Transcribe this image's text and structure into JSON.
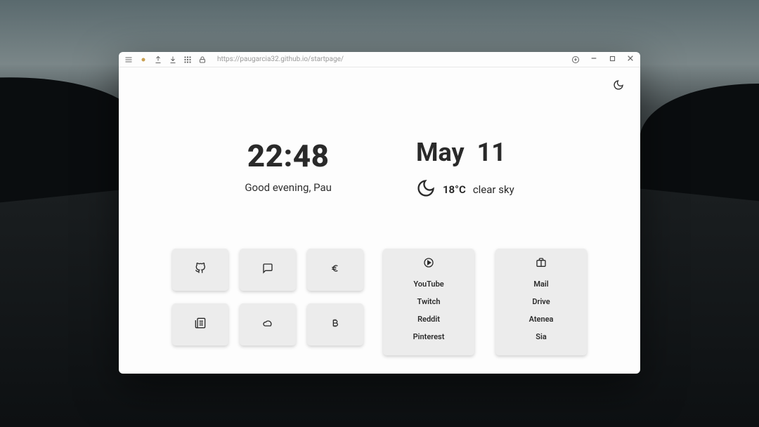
{
  "browser": {
    "url": "https://paugarcia32.github.io/startpage/"
  },
  "theme_icon": "moon-icon",
  "clock": {
    "time": "22:48",
    "greeting": "Good evening, Pau"
  },
  "date": {
    "month": "May",
    "day": "11"
  },
  "weather": {
    "icon": "moon-icon",
    "temperature": "18°C",
    "condition": "clear sky"
  },
  "tiles": [
    {
      "icon": "github-icon"
    },
    {
      "icon": "chat-icon"
    },
    {
      "icon": "euro-icon"
    },
    {
      "icon": "news-icon"
    },
    {
      "icon": "cloud-icon"
    },
    {
      "icon": "bitcoin-icon"
    }
  ],
  "lists": [
    {
      "icon": "play-icon",
      "items": [
        "YouTube",
        "Twitch",
        "Reddit",
        "Pinterest"
      ]
    },
    {
      "icon": "briefcase-icon",
      "items": [
        "Mail",
        "Drive",
        "Atenea",
        "Sia"
      ]
    }
  ]
}
